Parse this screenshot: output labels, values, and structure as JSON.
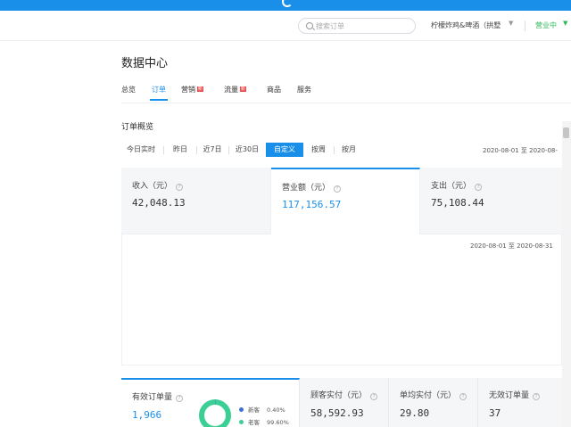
{
  "header": {
    "search_placeholder": "搜索订单",
    "shop_name": "柠檬炸鸡&啤酒（拱墅",
    "shop_caret": "▼",
    "status": "营业中",
    "status_caret": "▼"
  },
  "page": {
    "title": "数据中心"
  },
  "tabs": [
    {
      "label": "总览"
    },
    {
      "label": "订单"
    },
    {
      "label": "营销",
      "badge": "新"
    },
    {
      "label": "流量",
      "badge": "新"
    },
    {
      "label": "商品"
    },
    {
      "label": "服务"
    }
  ],
  "overview": {
    "title": "订单概览",
    "filters": [
      "今日实时",
      "昨日",
      "近7日",
      "近30日",
      "自定义",
      "按周",
      "按月"
    ],
    "date_range_top": "2020-08-01  至  2020-08-",
    "date_range_bottom": "2020-08-01  至  2020-08-31",
    "metrics": [
      {
        "label": "收入（元）",
        "value": "42,048.13"
      },
      {
        "label": "营业额（元）",
        "value": "117,156.57"
      },
      {
        "label": "支出（元）",
        "value": "75,108.44"
      }
    ]
  },
  "bottom": {
    "metrics": [
      {
        "label": "有效订单量",
        "value": "1,966"
      },
      {
        "label": "顾客实付（元）",
        "value": "58,592.93"
      },
      {
        "label": "单均实付（元）",
        "value": "29.80"
      },
      {
        "label": "无效订单量",
        "value": "37"
      }
    ],
    "legend": [
      {
        "label": "新客",
        "pct": "0.40%",
        "color": "#3b6fd6"
      },
      {
        "label": "老客",
        "pct": "99.60%",
        "color": "#3ccf95"
      }
    ]
  },
  "colors": {
    "brand": "#1a8fea",
    "status_green": "#2eb85c",
    "badge_red": "#f04848",
    "donut": "#3ccf95"
  },
  "icons": {
    "search": "search-icon",
    "info": "info-icon",
    "caret": "caret-down-icon"
  }
}
